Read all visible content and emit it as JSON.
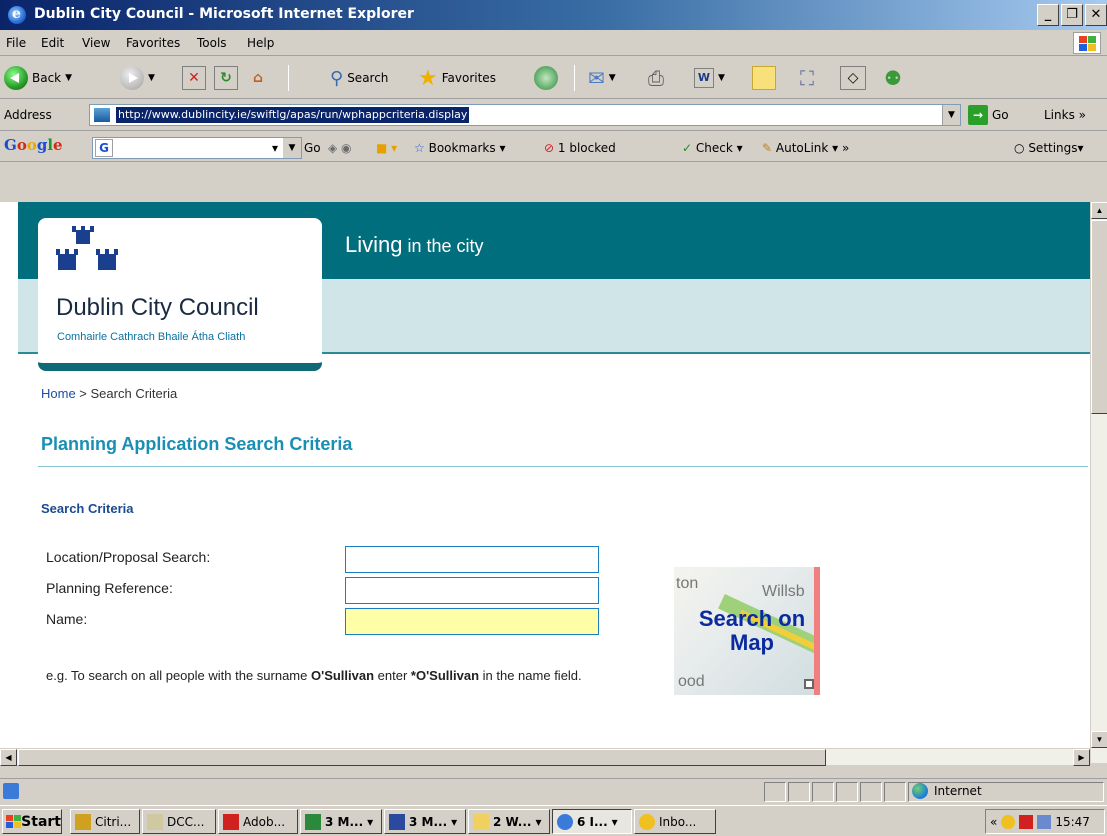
{
  "window": {
    "title": "Dublin City Council - Microsoft Internet Explorer",
    "minimize": "_",
    "maximize": "❐",
    "close": "✕"
  },
  "menu": [
    "File",
    "Edit",
    "View",
    "Favorites",
    "Tools",
    "Help"
  ],
  "toolbar": {
    "back_label": "Back",
    "search_label": "Search",
    "favorites_label": "Favorites"
  },
  "address": {
    "label": "Address",
    "url": "http://www.dublincity.ie/swiftlg/apas/run/wphappcriteria.display",
    "go_label": "Go",
    "links_label": "Links"
  },
  "googlebar": {
    "logo": [
      "G",
      "o",
      "o",
      "g",
      "l",
      "e"
    ],
    "go_label": "Go",
    "bookmarks_label": "Bookmarks",
    "blocked_label": "1 blocked",
    "check_label": "Check",
    "autolink_label": "AutoLink",
    "settings_label": "Settings"
  },
  "site": {
    "tagline_big": "Living",
    "tagline_rest": " in the city",
    "logo_name": "Dublin City Council",
    "logo_irish": "Comhairle Cathrach Bhaile Átha Cliath"
  },
  "breadcrumb": {
    "home": "Home",
    "separator": " > ",
    "current": "Search Criteria"
  },
  "page": {
    "title": "Planning Application Search Criteria",
    "section": "Search Criteria"
  },
  "form": {
    "fields": [
      {
        "label": "Location/Proposal Search:",
        "value": ""
      },
      {
        "label": "Planning Reference:",
        "value": ""
      },
      {
        "label": "Name:",
        "value": ""
      }
    ],
    "hint_prefix": "e.g. To search on all people with the surname ",
    "hint_bold1": "O'Sullivan",
    "hint_mid": " enter ",
    "hint_bold2": "*O'Sullivan",
    "hint_suffix": " in the name field."
  },
  "map_button": {
    "line1": "Search on",
    "line2": "Map",
    "street1": "ton",
    "street2": "Willsb",
    "street3": "ood"
  },
  "status": {
    "zone": "Internet"
  },
  "taskbar": {
    "start": "Start",
    "tasks": [
      "Citri...",
      "DCC...",
      "Adob...",
      "3 M...",
      "3 M...",
      "2 W...",
      "6 I...",
      "Inbo..."
    ],
    "clock": "15:47"
  },
  "colors": {
    "header_teal": "#006e7c",
    "header_light": "#cfe5e8",
    "title_blue": "#1a8fb5",
    "name_field_yellow": "#ffffa8"
  }
}
